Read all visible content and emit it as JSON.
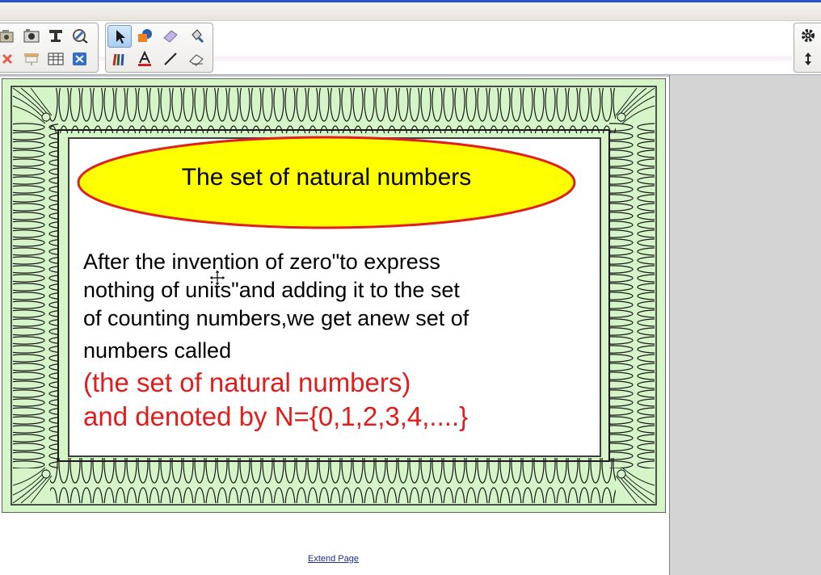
{
  "toolbar": {
    "left_group": [
      "folder-camera-icon",
      "camera-icon",
      "text-tool-icon",
      "magic-pen-icon",
      "delete-icon",
      "screen-shade-icon",
      "table-icon",
      "close-box-icon"
    ],
    "main_group": [
      "select-arrow-icon",
      "shapes-fill-icon",
      "eraser-pink-icon",
      "paint-fill-icon",
      "pens-icon",
      "text-a-icon",
      "line-icon",
      "eraser-icon"
    ],
    "right_group": [
      "settings-gear-icon",
      "move-toolbar-icon"
    ]
  },
  "page": {
    "title": "The set of natural numbers",
    "body_lines": [
      "After the invention of zero\"to express",
      "nothing of units\"and adding it to the set",
      "of counting numbers,we get anew set of",
      "numbers called"
    ],
    "red_lines": [
      "(the set of natural numbers)",
      "and denoted by N={0,1,2,3,4,....}"
    ],
    "extend_link": "Extend Page"
  },
  "colors": {
    "certificate_bg": "#d5f5c9",
    "ellipse_fill": "#ffff00",
    "ellipse_stroke": "#e0201e",
    "red_text": "#e41b1b",
    "gray_panel": "#d4d4d4"
  }
}
